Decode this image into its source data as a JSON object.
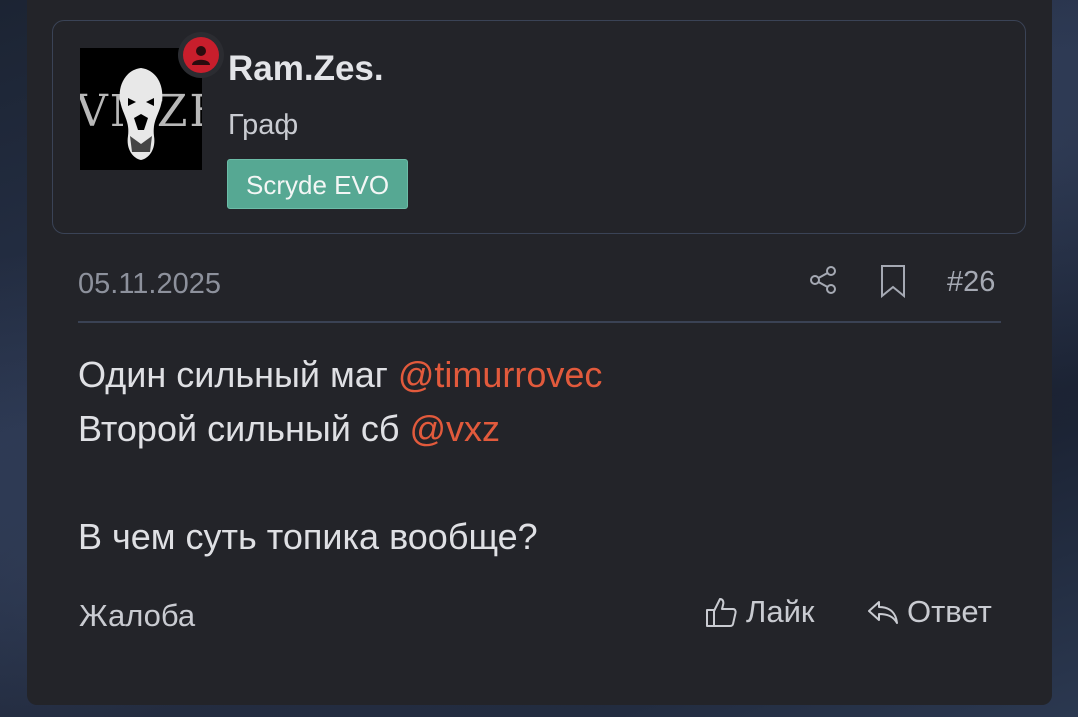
{
  "user": {
    "name": "Ram.Zes.",
    "rank": "Граф",
    "badge": "Scryde EVO",
    "avatar_text": "VMZE"
  },
  "meta": {
    "date": "05.11.2025",
    "post_number": "#26"
  },
  "body": {
    "line1_text": "Один сильный маг ",
    "line1_mention": "@timurrovec",
    "line2_text": "Второй сильный сб ",
    "line2_mention": "@vxz",
    "line3_text": "В чем суть топика вообще?"
  },
  "footer": {
    "report_label": "Жалоба",
    "like_label": "Лайк",
    "reply_label": "Ответ"
  },
  "colors": {
    "accent_mention": "#e25a3c",
    "badge_bg": "#56a893",
    "status_red": "#c81e2c"
  }
}
